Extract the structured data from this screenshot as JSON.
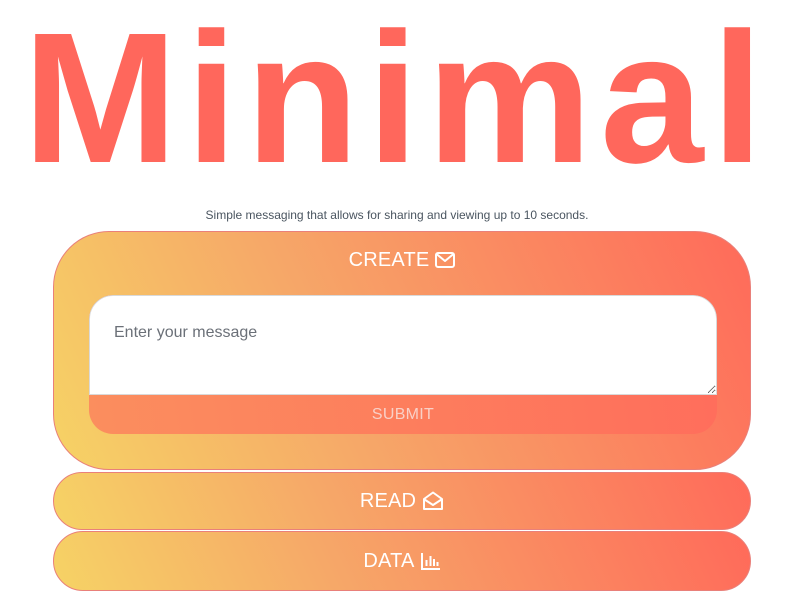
{
  "header": {
    "title": "Minimal",
    "subtitle": "Simple messaging that allows for sharing and viewing up to 10 seconds."
  },
  "sections": {
    "create": {
      "label": "CREATE",
      "icon": "envelope-icon",
      "message_placeholder": "Enter your message",
      "message_value": "",
      "submit_label": "SUBMIT"
    },
    "read": {
      "label": "READ",
      "icon": "envelope-open-icon"
    },
    "data": {
      "label": "DATA",
      "icon": "bar-chart-icon"
    }
  },
  "colors": {
    "title": "#ff675c",
    "gradient_start": "#f6d365",
    "gradient_end": "#ff6a5a",
    "text_on_panel": "#ffffff"
  }
}
